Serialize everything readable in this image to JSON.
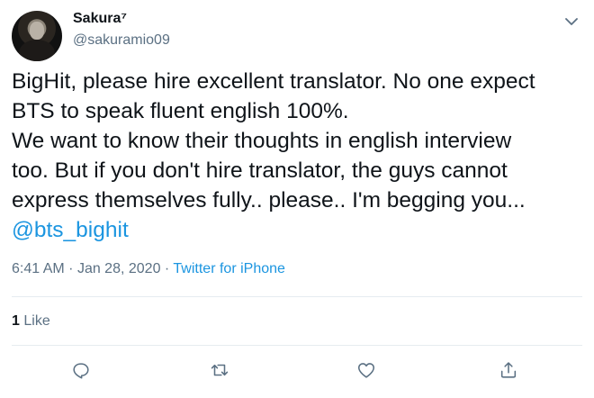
{
  "tweet": {
    "author_name": "Sakura⁷",
    "handle": "@sakuramio09",
    "text_lines": [
      "BigHit, please hire excellent translator. No one expect",
      "BTS to speak fluent english 100%.",
      "We want to know their thoughts in english interview",
      "too. But if you don't hire translator, the guys cannot",
      "express themselves fully.. please.. I'm begging you..."
    ],
    "mention": "@bts_bighit",
    "time": "6:41 AM",
    "date": "Jan 28, 2020",
    "separator": "·",
    "source": "Twitter for iPhone",
    "like_count": "1",
    "like_label": "Like"
  },
  "icons": {
    "menu": "chevron-down-icon",
    "reply": "reply-icon",
    "retweet": "retweet-icon",
    "like": "heart-icon",
    "share": "share-icon"
  },
  "colors": {
    "text": "#0f1419",
    "secondary": "#5b7083",
    "link": "#1b95e0",
    "divider": "#e6ecf0"
  }
}
